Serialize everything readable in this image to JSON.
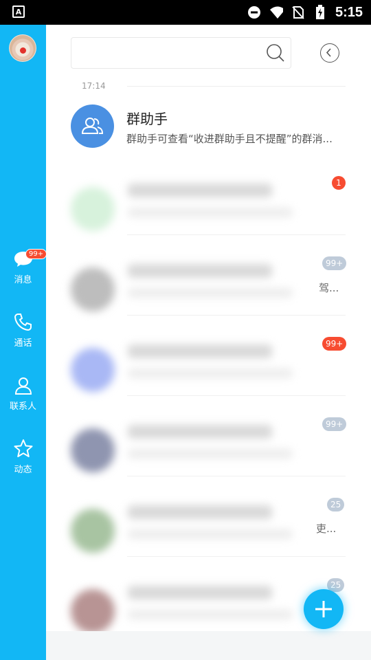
{
  "status_bar": {
    "time": "5:15",
    "left_icon": "A",
    "icons": [
      "do-not-disturb-icon",
      "wifi-icon",
      "no-sim-icon",
      "battery-charging-icon"
    ]
  },
  "sidebar": {
    "color": "#12b7f5",
    "items": [
      {
        "label": "消息",
        "icon": "message-icon",
        "badge": "99+"
      },
      {
        "label": "通话",
        "icon": "phone-icon"
      },
      {
        "label": "联系人",
        "icon": "contact-icon"
      },
      {
        "label": "动态",
        "icon": "star-icon"
      }
    ]
  },
  "header": {
    "search_icon": "search-icon",
    "back_icon": "back-icon"
  },
  "conversations": {
    "time_divider": "17:14",
    "helper": {
      "title": "群助手",
      "subtitle": "群助手可查看“收进群助手且不提醒”的群消..."
    },
    "badges": [
      "1",
      "99+",
      "99+",
      "99+",
      "25",
      "25"
    ],
    "badge_colors": {
      "red": "#f74c31",
      "gray": "#bfcbd9"
    },
    "truncated": [
      "驾...",
      "吏..."
    ]
  },
  "fab": {
    "icon": "plus-icon"
  }
}
